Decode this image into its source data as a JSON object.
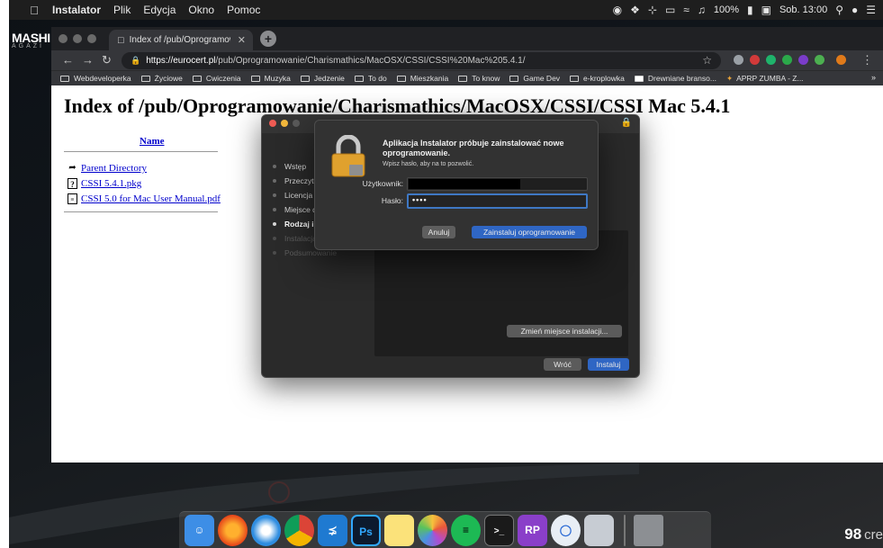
{
  "menubar": {
    "app_name": "Instalator",
    "items": [
      "Plik",
      "Edycja",
      "Okno",
      "Pomoc"
    ],
    "battery": "100%",
    "clock": "Sob. 13:00"
  },
  "brand": {
    "name": "MASHI",
    "sub": "AGAZI"
  },
  "browser": {
    "tab_title": "Index of /pub/Oprogramowanie",
    "url_host": "https://eurocert.pl",
    "url_path": "/pub/Oprogramowanie/Charismathics/MacOSX/CSSI/CSSI%20Mac%205.4.1/",
    "bookmarks": [
      "Webdeveloperka",
      "Życiowe",
      "Cwiczenia",
      "Muzyka",
      "Jedzenie",
      "To do",
      "Mieszkania",
      "To know",
      "Game Dev",
      "e-kroplowka",
      "Drewniane branso...",
      "APRP ZUMBA - Z..."
    ],
    "bookmarks_more": "»",
    "page": {
      "heading": "Index of /pub/Oprogramowanie/Charismathics/MacOSX/CSSI/CSSI Mac 5.4.1",
      "column_name": "Name",
      "entries": [
        {
          "label": "Parent Directory",
          "icon": "back-arrow-icon"
        },
        {
          "label": "CSSI 5.4.1.pkg",
          "icon": "unknown-file-icon"
        },
        {
          "label": "CSSI 5.0 for Mac User Manual.pdf",
          "icon": "document-icon"
        }
      ]
    }
  },
  "installer": {
    "steps": [
      {
        "label": "Wstęp",
        "state": "done"
      },
      {
        "label": "Przeczytaj mnie",
        "state": "done"
      },
      {
        "label": "Licencja",
        "state": "done"
      },
      {
        "label": "Miejsce docelowe",
        "state": "done"
      },
      {
        "label": "Rodzaj instalacji",
        "state": "active"
      },
      {
        "label": "Instalacja",
        "state": "pending"
      },
      {
        "label": "Podsumowanie",
        "state": "pending"
      }
    ],
    "change_location_label": "Zmień miejsce instalacji...",
    "back_label": "Wróć",
    "install_label": "Instaluj"
  },
  "auth_dialog": {
    "title": "Aplikacja Instalator próbuje zainstalować nowe oprogramowanie.",
    "subtitle": "Wpisz hasło, aby na to pozwolić.",
    "username_label": "Użytkownik:",
    "password_label": "Hasło:",
    "password_value": "••••",
    "cancel_label": "Anuluj",
    "confirm_label": "Zainstaluj oprogramowanie"
  },
  "dock": {
    "items": [
      "finder",
      "firefox",
      "safari",
      "chrome",
      "vscode",
      "photoshop",
      "notes",
      "photos",
      "spotify",
      "terminal",
      "rp",
      "sourcetree",
      "preview",
      "trash"
    ],
    "photoshop_text": "Ps",
    "rp_text": "RP"
  },
  "credit": {
    "mark": "98",
    "text": "cre"
  },
  "colors": {
    "accent_blue": "#2f66c4",
    "focus_ring": "#3f78c4",
    "link_blue": "#0000cc"
  }
}
